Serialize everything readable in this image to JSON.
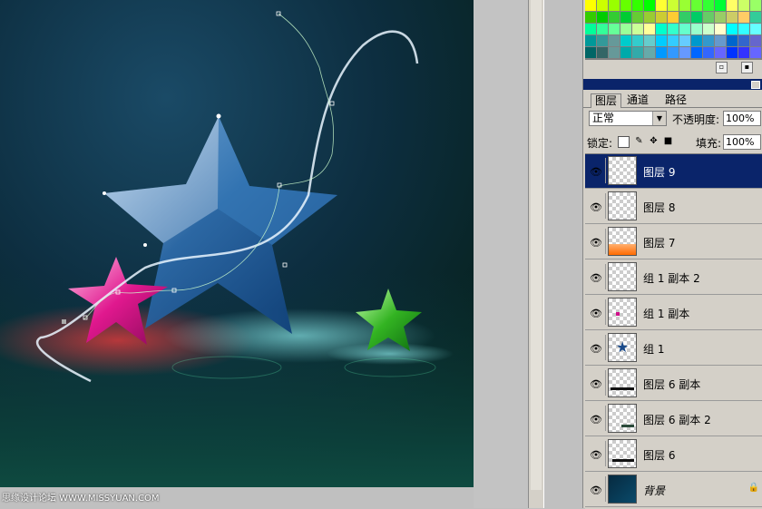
{
  "panel": {
    "tabs": [
      "图层",
      "通道",
      "路径"
    ],
    "blend_mode": "正常",
    "opacity_label": "不透明度:",
    "opacity_value": "100%",
    "lock_label": "锁定:",
    "fill_label": "填充:",
    "fill_value": "100%"
  },
  "layers": [
    {
      "name": "图层 9",
      "selected": true
    },
    {
      "name": "图层 8",
      "selected": false
    },
    {
      "name": "图层 7",
      "selected": false
    },
    {
      "name": "组 1 副本 2",
      "selected": false
    },
    {
      "name": "组 1 副本",
      "selected": false
    },
    {
      "name": "组 1",
      "selected": false
    },
    {
      "name": "图层 6 副本",
      "selected": false
    },
    {
      "name": "图层 6 副本 2",
      "selected": false
    },
    {
      "name": "图层 6",
      "selected": false
    },
    {
      "name": "背景",
      "selected": false
    }
  ],
  "watermark": "思缘设计论坛 WWW.MISSYUAN.COM",
  "colors": {
    "selection": "#0a246a",
    "panel_bg": "#d4d0c8",
    "canvas_bg": "#0b2a3a"
  }
}
